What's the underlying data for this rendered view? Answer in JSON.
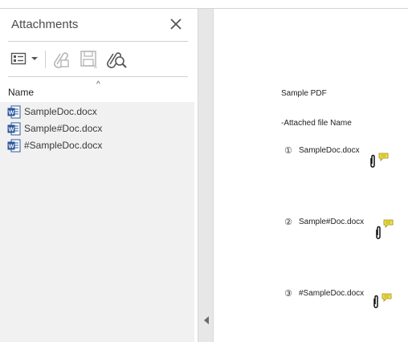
{
  "panel": {
    "title": "Attachments",
    "column_header": "Name",
    "sort_indicator": "^",
    "attachments": [
      {
        "name": "SampleDoc.docx"
      },
      {
        "name": "Sample#Doc.docx"
      },
      {
        "name": "#SampleDoc.docx"
      }
    ]
  },
  "document": {
    "title": "Sample PDF",
    "subtitle": "-Attached file Name",
    "items": [
      {
        "number": "①",
        "label": "SampleDoc.docx"
      },
      {
        "number": "②",
        "label": "Sample#Doc.docx"
      },
      {
        "number": "③",
        "label": "#SampleDoc.docx"
      }
    ]
  },
  "colors": {
    "word_blue": "#2b579a",
    "note_yellow": "#f5e24a",
    "icon_gray": "#555555",
    "disabled_gray": "#b5b5b5"
  },
  "icons": {
    "close": "close-icon",
    "options": "options-list-icon",
    "open": "open-attachment-icon",
    "save": "save-icon",
    "search": "search-attachment-icon",
    "word": "word-doc-icon",
    "paperclip": "paperclip-icon",
    "note": "comment-note-icon"
  }
}
